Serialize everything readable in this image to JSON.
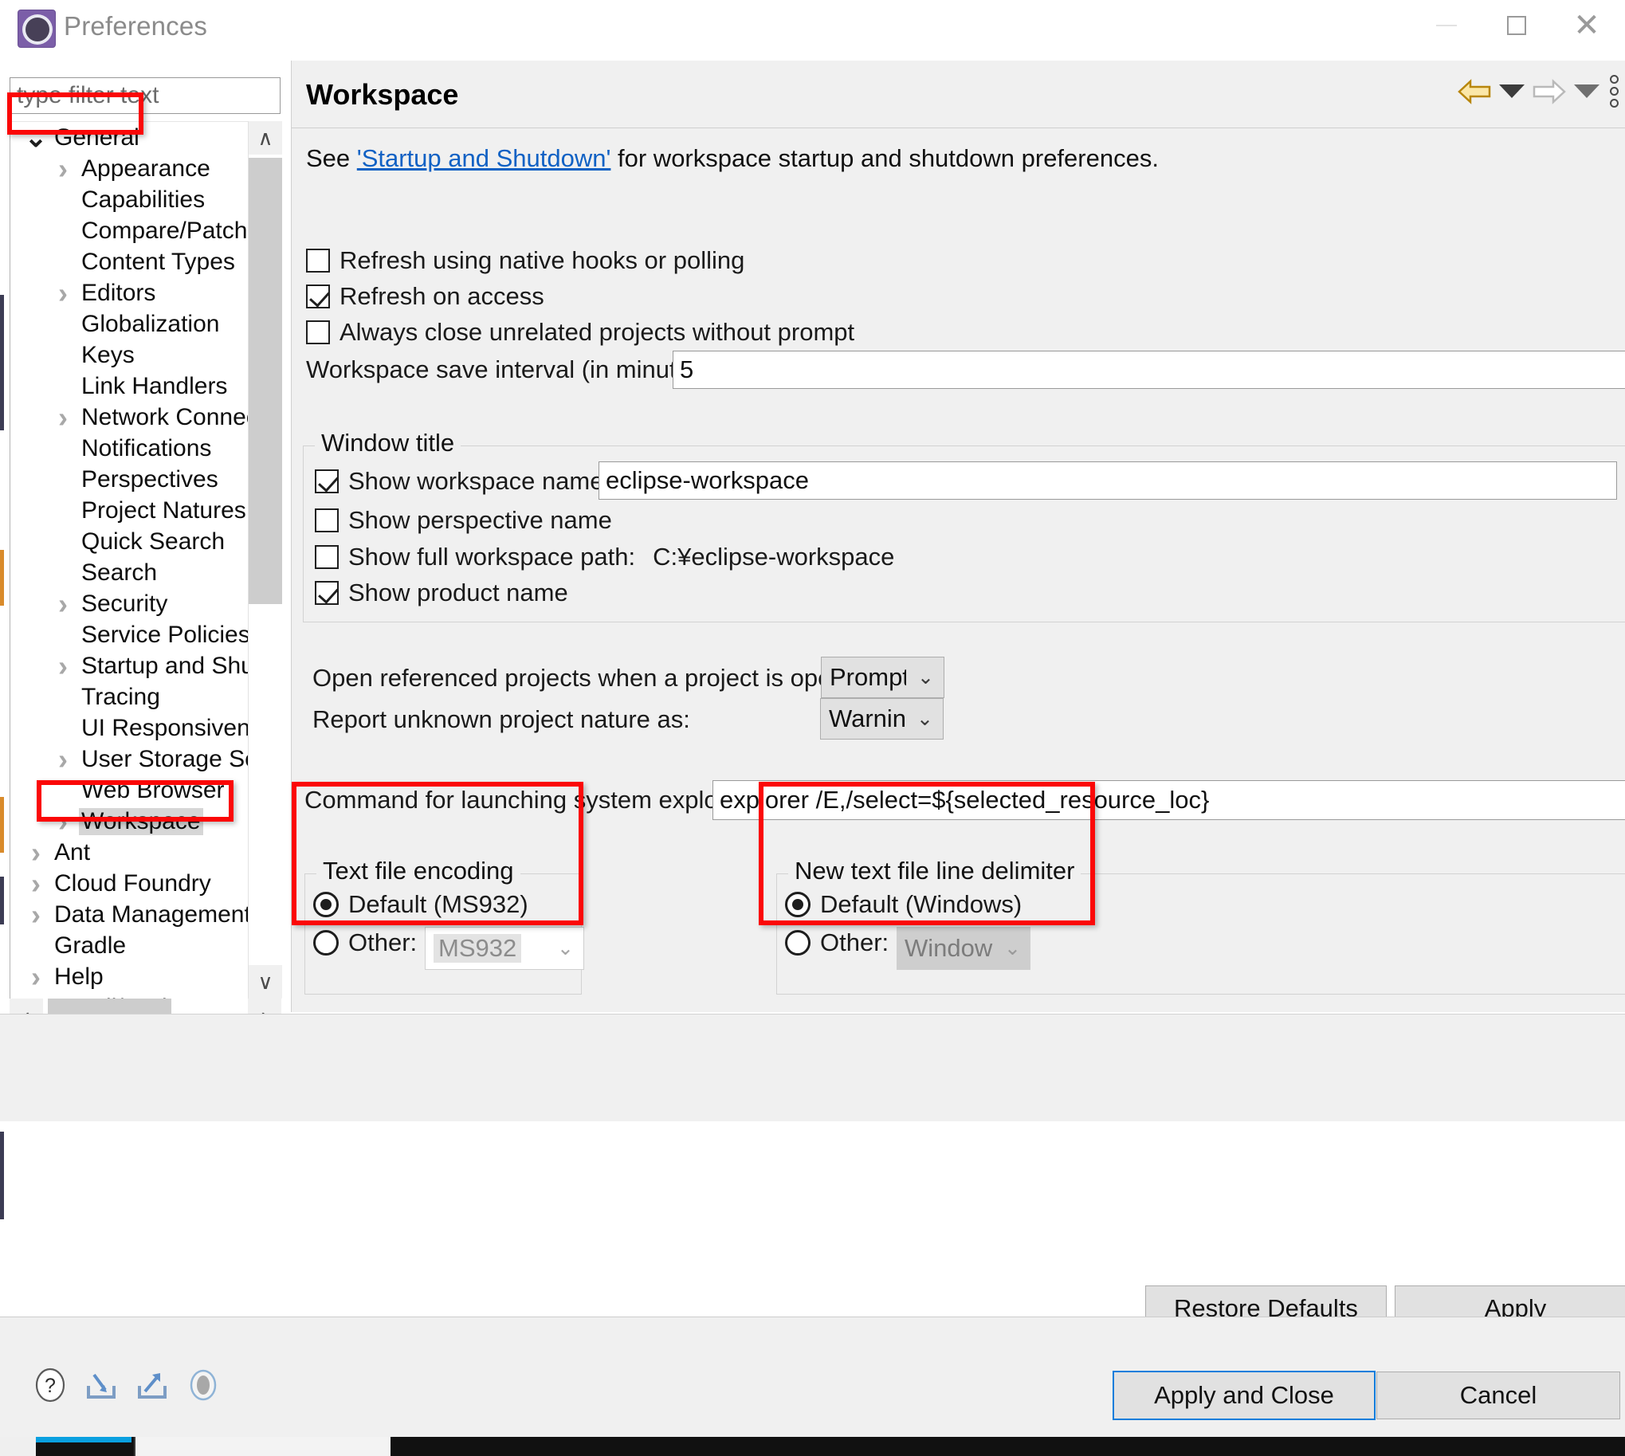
{
  "window": {
    "title": "Preferences",
    "icon": "eclipse-gear-icon",
    "minimize_label": "–",
    "maximize_label": "□",
    "close_label": "✕"
  },
  "filter": {
    "placeholder": "type filter text",
    "value": ""
  },
  "tree": {
    "items": [
      {
        "label": "General",
        "level": 0,
        "twisty": "down",
        "selected": false
      },
      {
        "label": "Appearance",
        "level": 1,
        "twisty": "right",
        "selected": false
      },
      {
        "label": "Capabilities",
        "level": 1,
        "twisty": "none",
        "selected": false
      },
      {
        "label": "Compare/Patch",
        "level": 1,
        "twisty": "none",
        "selected": false
      },
      {
        "label": "Content Types",
        "level": 1,
        "twisty": "none",
        "selected": false
      },
      {
        "label": "Editors",
        "level": 1,
        "twisty": "right",
        "selected": false
      },
      {
        "label": "Globalization",
        "level": 1,
        "twisty": "none",
        "selected": false
      },
      {
        "label": "Keys",
        "level": 1,
        "twisty": "none",
        "selected": false
      },
      {
        "label": "Link Handlers",
        "level": 1,
        "twisty": "none",
        "selected": false
      },
      {
        "label": "Network Connecti",
        "level": 1,
        "twisty": "right",
        "selected": false
      },
      {
        "label": "Notifications",
        "level": 1,
        "twisty": "none",
        "selected": false
      },
      {
        "label": "Perspectives",
        "level": 1,
        "twisty": "none",
        "selected": false
      },
      {
        "label": "Project Natures",
        "level": 1,
        "twisty": "none",
        "selected": false
      },
      {
        "label": "Quick Search",
        "level": 1,
        "twisty": "none",
        "selected": false
      },
      {
        "label": "Search",
        "level": 1,
        "twisty": "none",
        "selected": false
      },
      {
        "label": "Security",
        "level": 1,
        "twisty": "right",
        "selected": false
      },
      {
        "label": "Service Policies",
        "level": 1,
        "twisty": "none",
        "selected": false
      },
      {
        "label": "Startup and Shutd",
        "level": 1,
        "twisty": "right",
        "selected": false
      },
      {
        "label": "Tracing",
        "level": 1,
        "twisty": "none",
        "selected": false
      },
      {
        "label": "UI Responsiveness",
        "level": 1,
        "twisty": "none",
        "selected": false
      },
      {
        "label": "User Storage Serv",
        "level": 1,
        "twisty": "right",
        "selected": false
      },
      {
        "label": "Web Browser",
        "level": 1,
        "twisty": "none",
        "selected": false
      },
      {
        "label": "Workspace",
        "level": 1,
        "twisty": "right",
        "selected": true
      },
      {
        "label": "Ant",
        "level": 0,
        "twisty": "right",
        "selected": false
      },
      {
        "label": "Cloud Foundry",
        "level": 0,
        "twisty": "right",
        "selected": false
      },
      {
        "label": "Data Management",
        "level": 0,
        "twisty": "right",
        "selected": false
      },
      {
        "label": "Gradle",
        "level": 0,
        "twisty": "none",
        "selected": false
      },
      {
        "label": "Help",
        "level": 0,
        "twisty": "right",
        "selected": false
      },
      {
        "label": "Install/Update",
        "level": 0,
        "twisty": "right",
        "selected": false
      }
    ],
    "scroll_up_label": "∧",
    "scroll_down_label": "∨",
    "scroll_left_label": "‹",
    "scroll_right_label": "›"
  },
  "page": {
    "title": "Workspace",
    "see_prefix": "See ",
    "see_link": "'Startup and Shutdown'",
    "see_suffix": " for workspace startup and shutdown preferences.",
    "nav_back_icon": "arrow-left-icon",
    "nav_forward_icon": "arrow-right-icon",
    "nav_menu_icon": "chevron-down-icon",
    "nav_more_icon": "more-options-icon"
  },
  "checkboxes": [
    {
      "label": "Refresh using native hooks or polling",
      "checked": false
    },
    {
      "label": "Refresh on access",
      "checked": true
    },
    {
      "label": "Always close unrelated projects without prompt",
      "checked": false
    }
  ],
  "save_interval": {
    "label": "Workspace save interval (in minutes):",
    "value": "5"
  },
  "window_title_group": {
    "title": "Window title",
    "show_workspace_name": {
      "label": "Show workspace name:",
      "checked": true,
      "value": "eclipse-workspace"
    },
    "show_perspective_name": {
      "label": "Show perspective name",
      "checked": false
    },
    "show_full_workspace_path": {
      "label": "Show full workspace path:",
      "checked": false,
      "value": "C:¥eclipse-workspace"
    },
    "show_product_name": {
      "label": "Show product name",
      "checked": true
    }
  },
  "open_referenced": {
    "label": "Open referenced projects when a project is opened:",
    "value": "Prompt"
  },
  "report_nature": {
    "label": "Report unknown project nature as:",
    "value": "Warning"
  },
  "explorer_command": {
    "label": "Command for launching system explorer:",
    "value": "explorer /E,/select=${selected_resource_loc}"
  },
  "text_file_encoding": {
    "title": "Text file encoding",
    "default_label": "Default (MS932)",
    "default_selected": true,
    "other_label": "Other:",
    "other_selected": false,
    "other_value": "MS932"
  },
  "line_delimiter": {
    "title": "New text file line delimiter",
    "default_label": "Default (Windows)",
    "default_selected": true,
    "other_label": "Other:",
    "other_selected": false,
    "other_value": "Windows"
  },
  "page_buttons": {
    "restore_defaults": "Restore Defaults",
    "apply": "Apply"
  },
  "dialog_buttons": {
    "apply_and_close": "Apply and Close",
    "cancel": "Cancel"
  },
  "bottom_icons": [
    {
      "name": "help-icon"
    },
    {
      "name": "import-icon"
    },
    {
      "name": "export-icon"
    },
    {
      "name": "resize-grip-icon"
    }
  ],
  "colors": {
    "annotation": "#fb0707",
    "link": "#1061c4",
    "panel_bg": "#f0f0f0",
    "focus_border": "#0a7ddb"
  }
}
